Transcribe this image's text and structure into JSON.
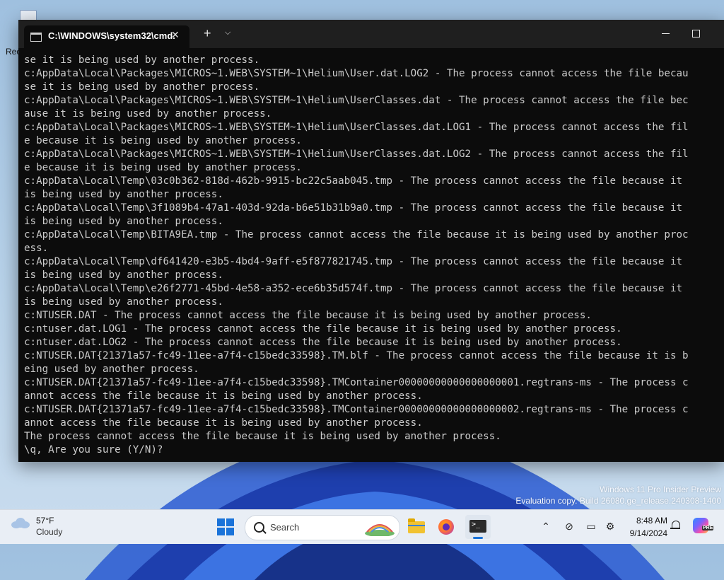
{
  "desktop": {
    "icon_label": "Rec",
    "watermark": [
      "Windows 11 Pro Insider Preview",
      "Evaluation copy. Build 26080.ge_release.240308-1400"
    ]
  },
  "terminal": {
    "tab_title": "C:\\WINDOWS\\system32\\cmd.",
    "tab_close": "✕",
    "new_tab": "+",
    "tab_menu": "⌵",
    "lines": [
      "se it is being used by another process.",
      "c:AppData\\Local\\Packages\\MICROS~1.WEB\\SYSTEM~1\\Helium\\User.dat.LOG2 - The process cannot access the file becau",
      "se it is being used by another process.",
      "c:AppData\\Local\\Packages\\MICROS~1.WEB\\SYSTEM~1\\Helium\\UserClasses.dat - The process cannot access the file bec",
      "ause it is being used by another process.",
      "c:AppData\\Local\\Packages\\MICROS~1.WEB\\SYSTEM~1\\Helium\\UserClasses.dat.LOG1 - The process cannot access the fil",
      "e because it is being used by another process.",
      "c:AppData\\Local\\Packages\\MICROS~1.WEB\\SYSTEM~1\\Helium\\UserClasses.dat.LOG2 - The process cannot access the fil",
      "e because it is being used by another process.",
      "c:AppData\\Local\\Temp\\03c0b362-818d-462b-9915-bc22c5aab045.tmp - The process cannot access the file because it",
      "is being used by another process.",
      "c:AppData\\Local\\Temp\\3f1089b4-47a1-403d-92da-b6e51b31b9a0.tmp - The process cannot access the file because it",
      "is being used by another process.",
      "c:AppData\\Local\\Temp\\BITA9EA.tmp - The process cannot access the file because it is being used by another proc",
      "ess.",
      "c:AppData\\Local\\Temp\\df641420-e3b5-4bd4-9aff-e5f877821745.tmp - The process cannot access the file because it",
      "is being used by another process.",
      "c:AppData\\Local\\Temp\\e26f2771-45bd-4e58-a352-ece6b35d574f.tmp - The process cannot access the file because it",
      "is being used by another process.",
      "c:NTUSER.DAT - The process cannot access the file because it is being used by another process.",
      "c:ntuser.dat.LOG1 - The process cannot access the file because it is being used by another process.",
      "c:ntuser.dat.LOG2 - The process cannot access the file because it is being used by another process.",
      "c:NTUSER.DAT{21371a57-fc49-11ee-a7f4-c15bedc33598}.TM.blf - The process cannot access the file because it is b",
      "eing used by another process.",
      "c:NTUSER.DAT{21371a57-fc49-11ee-a7f4-c15bedc33598}.TMContainer00000000000000000001.regtrans-ms - The process c",
      "annot access the file because it is being used by another process.",
      "c:NTUSER.DAT{21371a57-fc49-11ee-a7f4-c15bedc33598}.TMContainer00000000000000000002.regtrans-ms - The process c",
      "annot access the file because it is being used by another process.",
      "The process cannot access the file because it is being used by another process.",
      "\\q, Are you sure (Y/N)?"
    ]
  },
  "taskbar": {
    "weather_temp": "57°F",
    "weather_cond": "Cloudy",
    "search_placeholder": "Search",
    "time": "8:48 AM",
    "date": "9/14/2024",
    "copilot_badge": "PRE",
    "tray_icons": [
      "chevron-up-icon",
      "network-off-icon",
      "display-icon",
      "accessibility-icon",
      "language-icon"
    ]
  }
}
